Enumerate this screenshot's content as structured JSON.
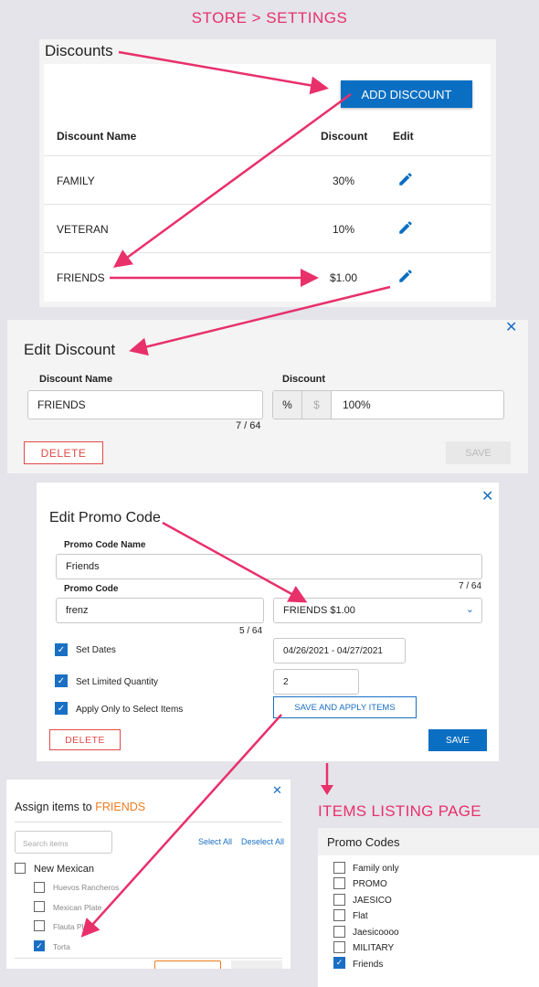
{
  "page_title": "STORE > SETTINGS",
  "discounts": {
    "title": "Discounts",
    "add_button": "ADD DISCOUNT",
    "col_name": "Discount Name",
    "col_discount": "Discount",
    "col_edit": "Edit",
    "rows": [
      {
        "name": "FAMILY",
        "value": "30%"
      },
      {
        "name": "VETERAN",
        "value": "10%"
      },
      {
        "name": "FRIENDS",
        "value": "$1.00"
      }
    ]
  },
  "edit_discount": {
    "title": "Edit Discount",
    "name_label": "Discount Name",
    "name_value": "FRIENDS",
    "char_count": "7 / 64",
    "discount_label": "Discount",
    "percent_symbol": "%",
    "dollar_symbol": "$",
    "value": "100%",
    "delete": "DELETE",
    "save": "SAVE"
  },
  "edit_promo": {
    "title": "Edit Promo Code",
    "name_label": "Promo Code Name",
    "name_value": "Friends",
    "name_count": "7 / 64",
    "code_label": "Promo Code",
    "code_value": "frenz",
    "code_count": "5 / 64",
    "discount_select": "FRIENDS $1.00",
    "set_dates": "Set Dates",
    "dates_value": "04/26/2021 - 04/27/2021",
    "set_qty": "Set Limited Quantity",
    "qty_value": "2",
    "apply_items": "Apply Only to Select Items",
    "save_apply": "SAVE AND APPLY ITEMS",
    "delete": "DELETE",
    "save": "SAVE"
  },
  "assign": {
    "title_prefix": "Assign items to ",
    "title_name": "FRIENDS",
    "search_placeholder": "Search items",
    "select_all": "Select All",
    "deselect_all": "Deselect All",
    "category": "New Mexican",
    "items": [
      {
        "label": "Huevos Rancheros",
        "checked": false
      },
      {
        "label": "Mexican Plate",
        "checked": false
      },
      {
        "label": "Flauta Plate",
        "checked": false
      },
      {
        "label": "Torta",
        "checked": true
      }
    ]
  },
  "items_listing": {
    "heading": "ITEMS LISTING PAGE",
    "panel_title": "Promo Codes",
    "codes": [
      {
        "label": "Family only",
        "checked": false
      },
      {
        "label": "PROMO",
        "checked": false
      },
      {
        "label": "JAESICO",
        "checked": false
      },
      {
        "label": "Flat",
        "checked": false
      },
      {
        "label": "Jaesicoooo",
        "checked": false
      },
      {
        "label": "MILITARY",
        "checked": false
      },
      {
        "label": "Friends",
        "checked": true
      }
    ]
  },
  "colors": {
    "accent": "#e8306b",
    "primary": "#0a6fc2",
    "danger": "#e24a4a",
    "orange": "#f07b1e"
  }
}
